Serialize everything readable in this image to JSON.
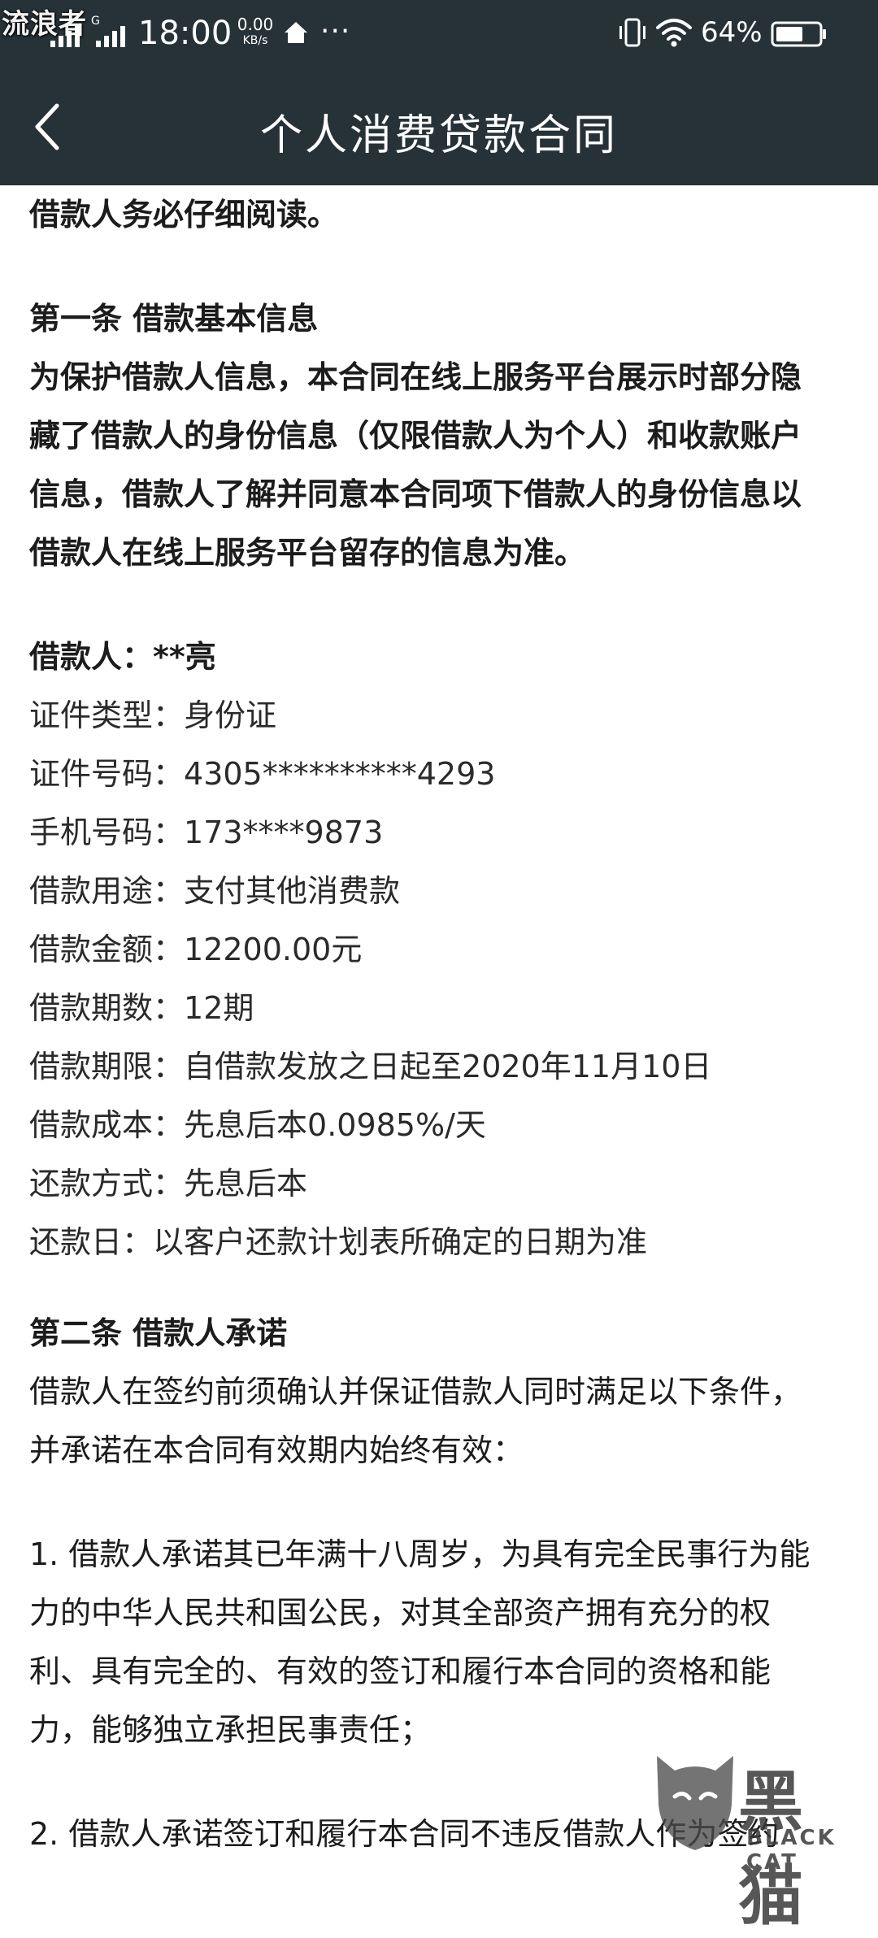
{
  "status_bar": {
    "watermark": "流浪者",
    "network_label": "G",
    "time": "18:00",
    "speed_value": "0.00",
    "speed_unit": "KB/s",
    "more": "···",
    "battery": "64%"
  },
  "nav": {
    "title": "个人消费贷款合同"
  },
  "content": {
    "intro": "借款人务必仔细阅读。",
    "section1": {
      "heading": "第一条 借款基本信息",
      "para": [
        "为保护借款人信息，本合同在线上服务平台展示时部分隐",
        "藏了借款人的身份信息（仅限借款人为个人）和收款账户",
        "信息，借款人了解并同意本合同项下借款人的身份信息以",
        "借款人在线上服务平台留存的信息为准。"
      ]
    },
    "borrower": "借款人：**亮",
    "fields": [
      {
        "label": "证件类型：",
        "value": "身份证"
      },
      {
        "label": "证件号码：",
        "value": "4305**********4293"
      },
      {
        "label": "手机号码：",
        "value": "173****9873"
      },
      {
        "label": "借款用途：",
        "value": "支付其他消费款"
      },
      {
        "label": "借款金额：",
        "value": "12200.00元"
      },
      {
        "label": "借款期数：",
        "value": "12期"
      },
      {
        "label": "借款期限：",
        "value": "自借款发放之日起至2020年11月10日"
      },
      {
        "label": "借款成本：",
        "value": "先息后本0.0985%/天"
      },
      {
        "label": "还款方式：",
        "value": "先息后本"
      },
      {
        "label": "还款日：",
        "value": "以客户还款计划表所确定的日期为准"
      }
    ],
    "section2": {
      "heading": "第二条 借款人承诺",
      "para": [
        "借款人在签约前须确认并保证借款人同时满足以下条件，",
        "并承诺在本合同有效期内始终有效："
      ],
      "item1": [
        "1. 借款人承诺其已年满十八周岁，为具有完全民事行为能",
        "力的中华人民共和国公民，对其全部资产拥有充分的权",
        "利、具有完全的、有效的签订和履行本合同的资格和能",
        "力，能够独立承担民事责任；"
      ],
      "item2_partial": "2. 借款人承诺签订和履行本合同不违反借款人作为签约"
    }
  },
  "logo": {
    "cn": "黑猫",
    "en": "BLACK CAT"
  }
}
